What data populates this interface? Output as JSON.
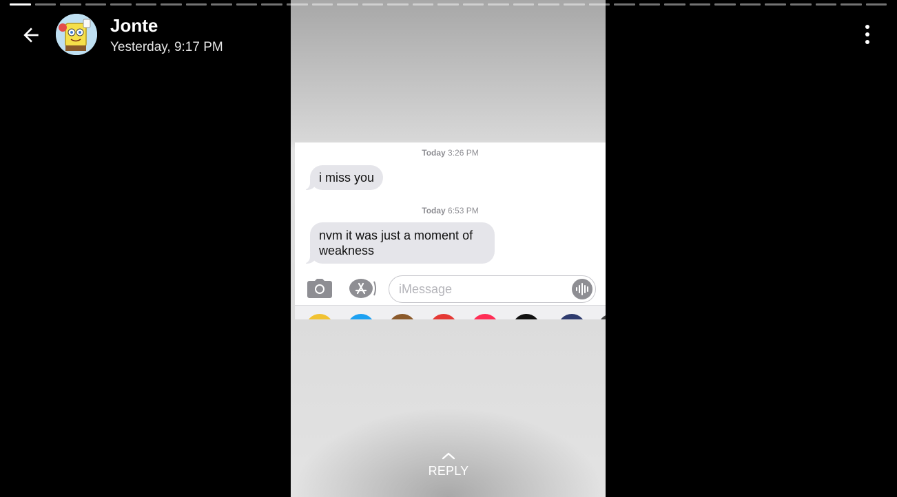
{
  "story": {
    "progress": {
      "segments": 35,
      "current": 1
    },
    "author": {
      "name": "Jonte",
      "posted": "Yesterday, 9:17 PM",
      "avatar_icon": "cartoon-sponge-avatar"
    },
    "header": {
      "back_icon": "arrow-left-icon",
      "menu_icon": "more-vert-icon"
    },
    "content": {
      "conversation": [
        {
          "timestamp_day": "Today",
          "timestamp_time": "3:26 PM",
          "message": "i miss you"
        },
        {
          "timestamp_day": "Today",
          "timestamp_time": "6:53 PM",
          "message": "nvm it was just a moment of weakness"
        }
      ],
      "composer": {
        "placeholder": "iMessage",
        "camera_icon": "camera-icon",
        "appstore_icon": "app-store-icon",
        "audio_icon": "audio-waveform-icon"
      },
      "app_tray_colors": [
        "#f1c232",
        "#1da1f2",
        "#8b5a2b",
        "#e53935",
        "#ff2d55",
        "#111111",
        "#2e3b6e",
        "#444444"
      ]
    },
    "reply": {
      "label": "REPLY",
      "icon": "chevron-up-icon"
    }
  },
  "colors": {
    "background": "#000000",
    "bubble": "#e5e5ea",
    "timestamp": "#8e8e93"
  }
}
